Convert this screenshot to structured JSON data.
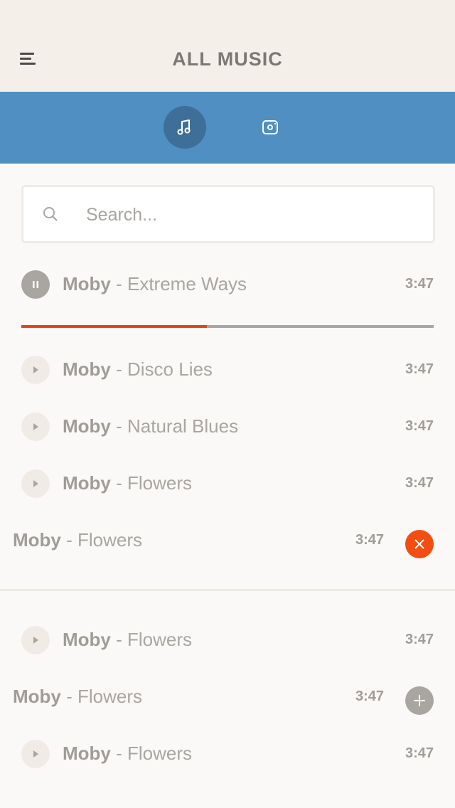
{
  "header": {
    "title": "ALL MUSIC",
    "menu_icon": "hamburger-menu-icon"
  },
  "tabs": [
    {
      "icon": "music-note-icon",
      "active": true
    },
    {
      "icon": "disc-icon",
      "active": false
    }
  ],
  "search": {
    "placeholder": "Search...",
    "value": ""
  },
  "now_playing": {
    "artist": "Moby",
    "title": " - Extreme Ways",
    "duration": "3:47",
    "state": "playing",
    "progress": 0.45
  },
  "tracks": [
    {
      "artist": "Moby",
      "title": " - Disco Lies",
      "duration": "3:47"
    },
    {
      "artist": "Moby",
      "title": " - Natural Blues",
      "duration": "3:47"
    },
    {
      "artist": "Moby",
      "title": " - Flowers",
      "duration": "3:47"
    },
    {
      "artist": "Moby",
      "title": " - Flowers",
      "duration": "3:47",
      "action": "remove"
    },
    {
      "artist": "Moby",
      "title": " - Flowers",
      "duration": "3:47"
    },
    {
      "artist": "Moby",
      "title": " - Flowers",
      "duration": "3:47",
      "action": "add"
    },
    {
      "artist": "Moby",
      "title": " - Flowers",
      "duration": "3:47"
    }
  ],
  "colors": {
    "header_bg": "#f5efea",
    "tabbar_bg": "#4f8fc2",
    "active_tab": "#3e6f98",
    "progress": "#e0461a",
    "remove": "#f24e12",
    "neutral": "#a9a5a1"
  }
}
